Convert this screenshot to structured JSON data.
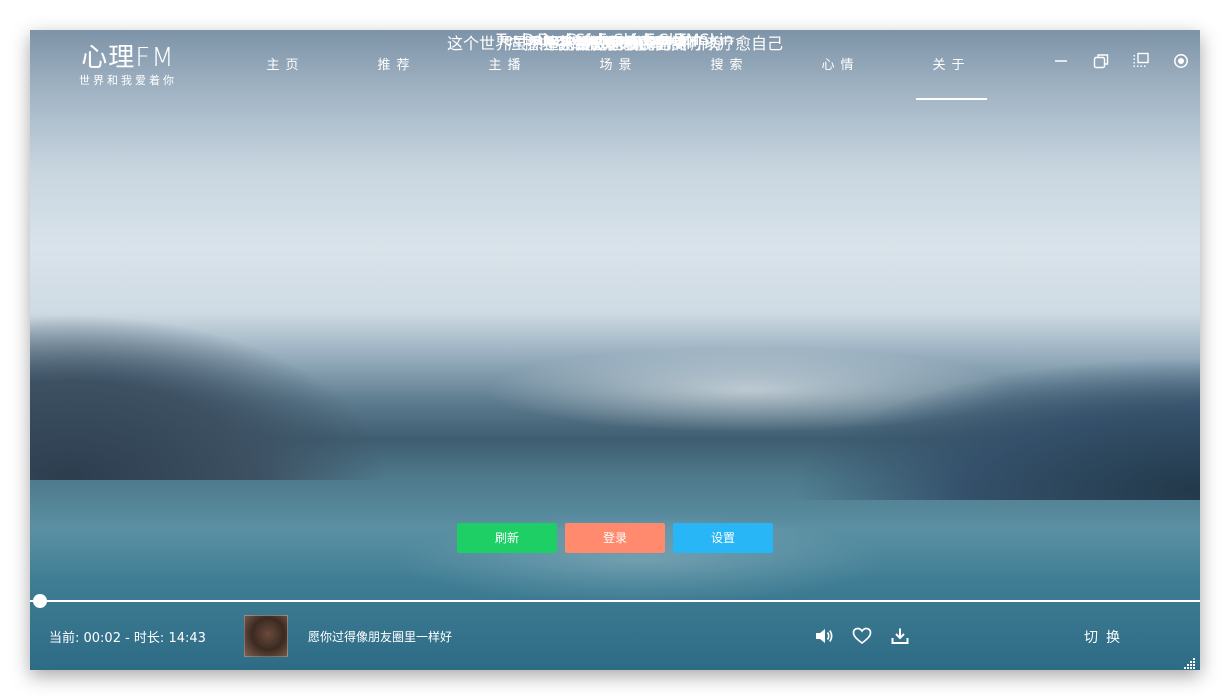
{
  "app": {
    "name": "心理FM",
    "slogan": "世界和我爱着你"
  },
  "nav": [
    {
      "label": "主页",
      "active": false
    },
    {
      "label": "推荐",
      "active": false
    },
    {
      "label": "主播",
      "active": false
    },
    {
      "label": "场景",
      "active": false
    },
    {
      "label": "搜索",
      "active": false
    },
    {
      "label": "心情",
      "active": false
    },
    {
      "label": "关于",
      "active": true
    }
  ],
  "window_controls": [
    "minimize-icon",
    "restore-icon",
    "skin-icon",
    "settings-icon"
  ],
  "about": {
    "title": "心理FM",
    "design": "Design For AduSkin",
    "thanks": "特别鸣谢",
    "data": "Data Guidance For Tom",
    "tech": "Technical Support For DMSkin",
    "copyright": "广播内容版权均为心理FM所有",
    "motto": "坚持给时间一点时间",
    "motto_sub": "这个世界虽然不完美，但我们仍然可以疗愈自己",
    "brand": "AduSkin",
    "brand_sub": "追求极致，永臻完美"
  },
  "buttons": {
    "refresh": "刷新",
    "login": "登录",
    "settings": "设置"
  },
  "colors": {
    "refresh": "#1ecf66",
    "login": "#ff8a6d",
    "settings": "#29b6f6"
  },
  "player": {
    "time_text": "当前: 00:02 - 时长: 14:43",
    "progress": 0.0023,
    "song": "愿你过得像朋友圈里一样好",
    "icons": [
      "volume-icon",
      "heart-icon",
      "download-icon"
    ],
    "switch_label": "切换"
  }
}
